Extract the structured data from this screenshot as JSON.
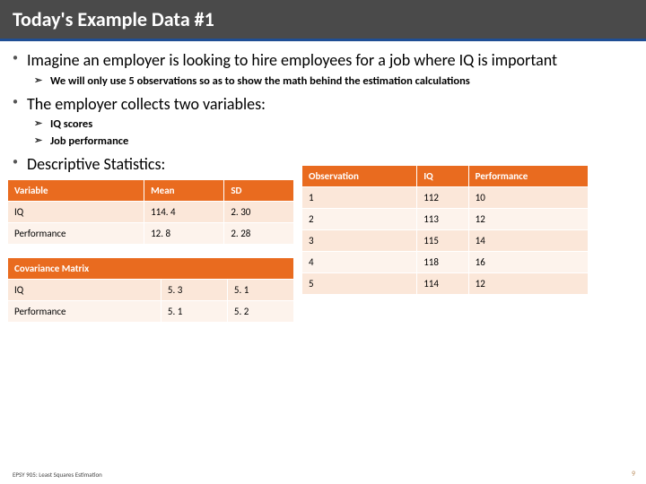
{
  "header": {
    "title": "Today's Example Data #1"
  },
  "bullets": {
    "b1": "Imagine an employer is looking to hire employees for a job where IQ is important",
    "b1s1": "We will only use 5 observations so as to show the math behind the estimation calculations",
    "b2": "The employer collects two variables:",
    "b2s1": "IQ scores",
    "b2s2": "Job performance",
    "b3": "Descriptive Statistics:"
  },
  "desc_table": {
    "headers": [
      "Variable",
      "Mean",
      "SD"
    ],
    "rows": [
      [
        "IQ",
        "114. 4",
        "2. 30"
      ],
      [
        "Performance",
        "12. 8",
        "2. 28"
      ]
    ]
  },
  "cov_table": {
    "title": "Covariance Matrix",
    "rows": [
      [
        "IQ",
        "5. 3",
        "5. 1"
      ],
      [
        "Performance",
        "5. 1",
        "5. 2"
      ]
    ]
  },
  "obs_table": {
    "headers": [
      "Observation",
      "IQ",
      "Performance"
    ],
    "rows": [
      [
        "1",
        "112",
        "10"
      ],
      [
        "2",
        "113",
        "12"
      ],
      [
        "3",
        "115",
        "14"
      ],
      [
        "4",
        "118",
        "16"
      ],
      [
        "5",
        "114",
        "12"
      ]
    ]
  },
  "footer": {
    "left": "EPSY 905: Least Squares Estimation",
    "right": "9"
  },
  "chart_data": [
    {
      "type": "table",
      "title": "Descriptive Statistics",
      "columns": [
        "Variable",
        "Mean",
        "SD"
      ],
      "rows": [
        {
          "Variable": "IQ",
          "Mean": 114.4,
          "SD": 2.3
        },
        {
          "Variable": "Performance",
          "Mean": 12.8,
          "SD": 2.28
        }
      ]
    },
    {
      "type": "table",
      "title": "Covariance Matrix",
      "columns": [
        "",
        "IQ",
        "Performance"
      ],
      "rows": [
        {
          "": "IQ",
          "IQ": 5.3,
          "Performance": 5.1
        },
        {
          "": "Performance",
          "IQ": 5.1,
          "Performance": 5.2
        }
      ]
    },
    {
      "type": "table",
      "title": "Observations",
      "columns": [
        "Observation",
        "IQ",
        "Performance"
      ],
      "rows": [
        {
          "Observation": 1,
          "IQ": 112,
          "Performance": 10
        },
        {
          "Observation": 2,
          "IQ": 113,
          "Performance": 12
        },
        {
          "Observation": 3,
          "IQ": 115,
          "Performance": 14
        },
        {
          "Observation": 4,
          "IQ": 118,
          "Performance": 16
        },
        {
          "Observation": 5,
          "IQ": 114,
          "Performance": 12
        }
      ]
    }
  ]
}
